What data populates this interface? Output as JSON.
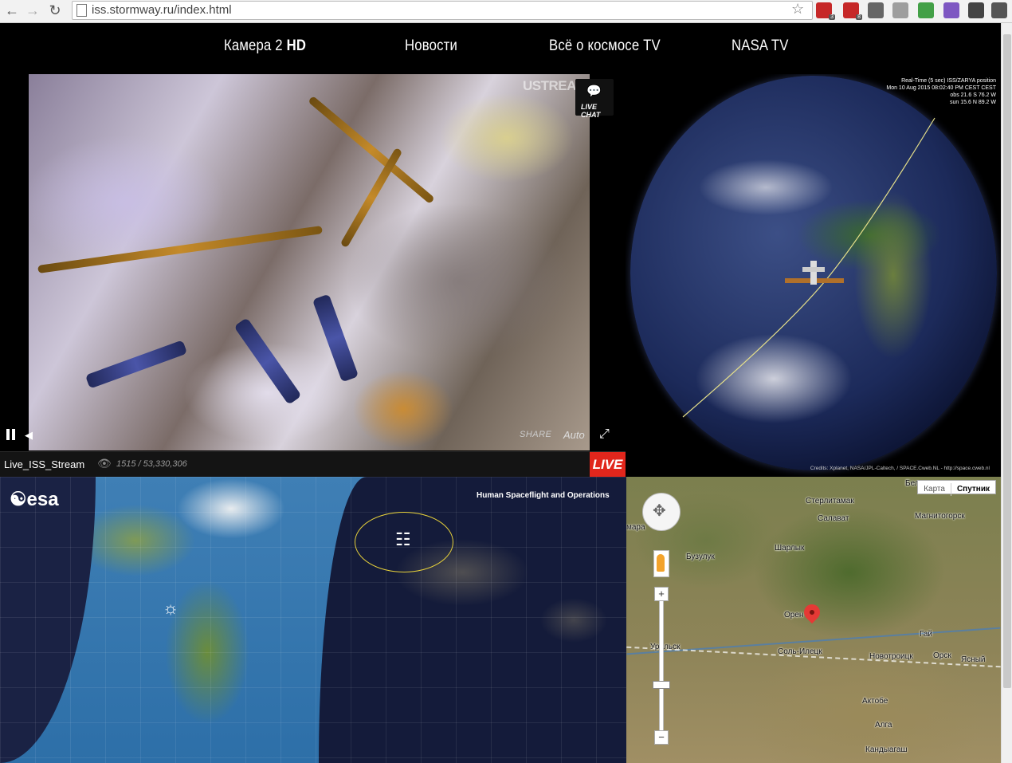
{
  "browser": {
    "url": "iss.stormway.ru/index.html",
    "extensions": [
      {
        "icon": "adblock-icon",
        "badge": "3",
        "color": "#c62828"
      },
      {
        "icon": "abp-icon",
        "badge": "8",
        "color": "#c62828"
      },
      {
        "icon": "download-icon",
        "badge": "",
        "color": "#666666"
      },
      {
        "icon": "shield-icon",
        "badge": "",
        "color": "#9e9e9e"
      },
      {
        "icon": "chart-icon",
        "badge": "",
        "color": "#43a047"
      },
      {
        "icon": "translate-icon",
        "badge": "",
        "color": "#7e57c2"
      },
      {
        "icon": "glasses-icon",
        "badge": "",
        "color": "#444444"
      },
      {
        "icon": "menu-icon",
        "badge": "",
        "color": "#555555"
      }
    ]
  },
  "nav": {
    "items": [
      {
        "label": "Камера 2",
        "strong": "HD"
      },
      {
        "label": "Новости",
        "strong": ""
      },
      {
        "label": "Всё о космосе TV",
        "strong": ""
      },
      {
        "label": "NASA TV",
        "strong": ""
      }
    ]
  },
  "video": {
    "logo": "USTREAM",
    "live_chat": "LIVE CHAT",
    "share": "SHARE",
    "quality": "Auto",
    "stream_name": "Live_ISS_Stream",
    "viewers": "1515 / 53,330,306",
    "live_badge": "LIVE"
  },
  "globe": {
    "info_lines": [
      "Real-Time (5 sec) ISS/ZARYA position",
      "Mon 10 Aug 2015 08:02:40 PM CEST CEST",
      "obs 21.6 S  76.2 W",
      "sun 15.6 N  89.2 W"
    ],
    "credits": "Credits: Xplanet, NASA/JPL-Caltech, / SPACE.Cweb.NL - http://space.cweb.nl"
  },
  "esa_map": {
    "logo": "esa",
    "header": "Human Spaceflight and Operations"
  },
  "gmap": {
    "map_types": [
      "Карта",
      "Спутник"
    ],
    "active_map_type": "Спутник",
    "zoom_in": "+",
    "zoom_out": "−",
    "cities": [
      "Белебей",
      "Стерлитамак",
      "Салават",
      "Магнитогорск",
      "Самара",
      "Бузулук",
      "Шарлык",
      "Оренбург",
      "Уральск",
      "Соль-Илецк",
      "Гай",
      "Новотроицк",
      "Орск",
      "Ясный",
      "Актобе",
      "Алга",
      "Кандыагаш"
    ],
    "city_labels_shown": [
      "Бел",
      "Стерлитамак",
      "Салават",
      "Магнитогорск",
      "мара",
      "Бузулук",
      "Шарлык",
      "Орен",
      "Уральск",
      "Соль-Илецк",
      "Гай",
      "Новотроицк",
      "Орск",
      "Ясный",
      "Актобе",
      "Алга",
      "Кандыагаш"
    ]
  }
}
